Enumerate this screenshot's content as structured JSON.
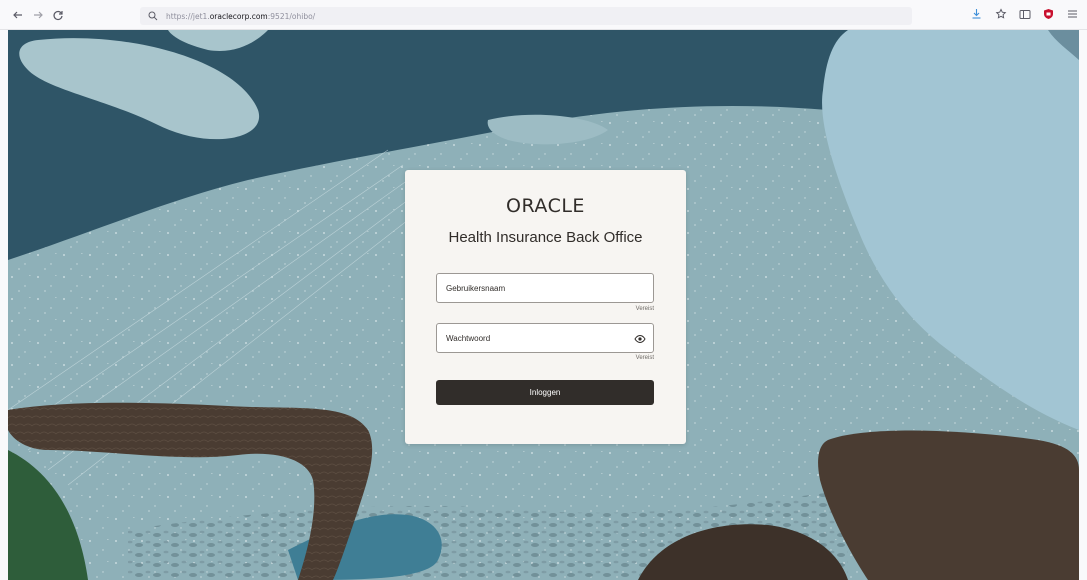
{
  "browser": {
    "url_prefix": "https://jet1.",
    "url_host": "oraclecorp.com",
    "url_suffix": ":9521/ohibo/",
    "icons": [
      "back-icon",
      "forward-icon",
      "reload-icon",
      "search-icon",
      "download-icon",
      "bookmark-icon",
      "sidebar-icon",
      "shield-extension-icon",
      "menu-icon"
    ]
  },
  "login": {
    "logo": "ORACLE",
    "app_title": "Health Insurance Back Office",
    "username_placeholder": "Gebruikersnaam",
    "username_required": "Vereist",
    "password_placeholder": "Wachtwoord",
    "password_required": "Vereist",
    "login_button": "Inloggen"
  },
  "colors": {
    "card_bg": "#f7f5f2",
    "button_bg": "#312d2a",
    "text_dark": "#312d2a",
    "background_teal": "#8fb2ba",
    "dark_blue": "#2f5567",
    "brown": "#4a3c32"
  }
}
